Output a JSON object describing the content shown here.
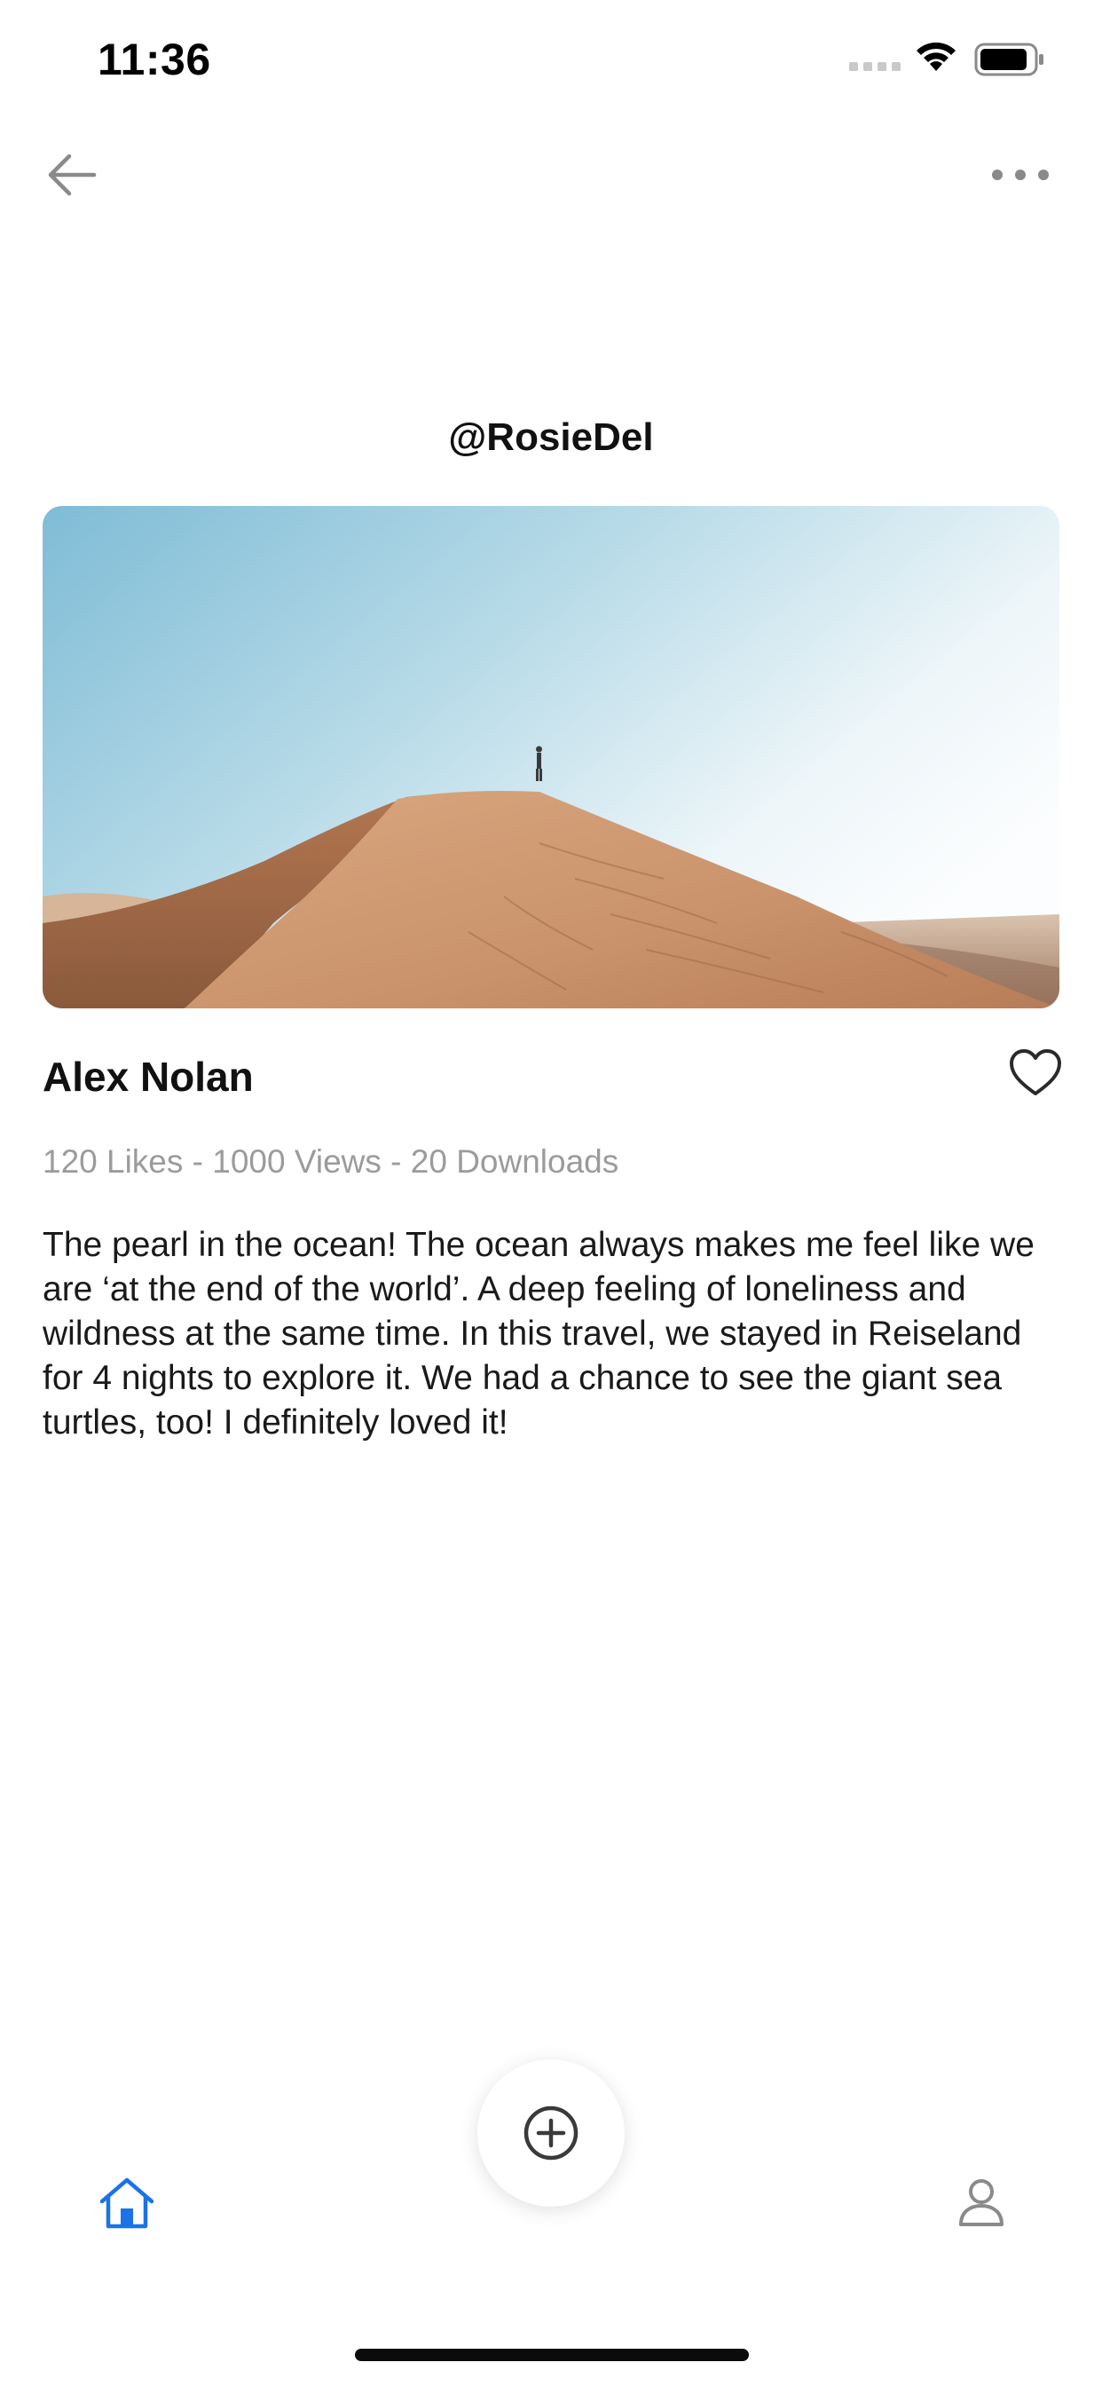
{
  "status_bar": {
    "time": "11:36",
    "signal_icon": "signal-icon",
    "wifi_icon": "wifi-icon",
    "battery_icon": "battery-icon"
  },
  "nav": {
    "back_icon": "arrow-left-icon",
    "more_icon": "more-horizontal-icon"
  },
  "profile": {
    "handle": "@RosieDel"
  },
  "post": {
    "image_subject": "desert-dune-photo",
    "author": "Alex Nolan",
    "like_icon": "heart-icon",
    "stats": "120 Likes - 1000 Views - 20 Downloads",
    "description": "The pearl in the ocean! The ocean always makes me feel like we are ‘at the end of the world’. A deep feeling of loneliness and wildness at the same time. In this travel, we stayed in Reiseland for 4 nights to explore it. We had a chance to see the giant sea turtles, too! I definitely loved it!"
  },
  "tab_bar": {
    "home_icon": "home-icon",
    "add_icon": "plus-circle-icon",
    "profile_icon": "user-icon",
    "active_tab": "home"
  },
  "colors": {
    "accent": "#1a73e8",
    "text": "#111111",
    "muted": "#9b9b9b",
    "icon_gray": "#8a8a8a"
  }
}
